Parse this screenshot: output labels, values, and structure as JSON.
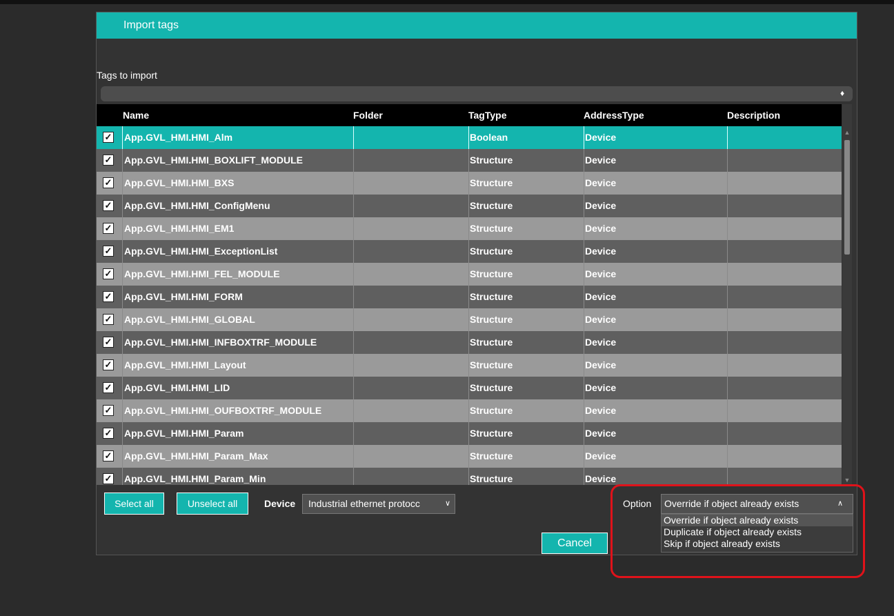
{
  "dialog": {
    "title": "Import tags",
    "tags_label": "Tags to import",
    "filter_icon": "tag-icon"
  },
  "grid": {
    "columns": [
      "Name",
      "Folder",
      "TagType",
      "AddressType",
      "Description"
    ],
    "rows": [
      {
        "name": "App.GVL_HMI.HMI_Alm",
        "folder": "",
        "tagtype": "Boolean",
        "addresstype": "Device",
        "description": "",
        "checked": true,
        "selected": true
      },
      {
        "name": "App.GVL_HMI.HMI_BOXLIFT_MODULE",
        "folder": "",
        "tagtype": "Structure",
        "addresstype": "Device",
        "description": "",
        "checked": true
      },
      {
        "name": "App.GVL_HMI.HMI_BXS",
        "folder": "",
        "tagtype": "Structure",
        "addresstype": "Device",
        "description": "",
        "checked": true
      },
      {
        "name": "App.GVL_HMI.HMI_ConfigMenu",
        "folder": "",
        "tagtype": "Structure",
        "addresstype": "Device",
        "description": "",
        "checked": true
      },
      {
        "name": "App.GVL_HMI.HMI_EM1",
        "folder": "",
        "tagtype": "Structure",
        "addresstype": "Device",
        "description": "",
        "checked": true
      },
      {
        "name": "App.GVL_HMI.HMI_ExceptionList",
        "folder": "",
        "tagtype": "Structure",
        "addresstype": "Device",
        "description": "",
        "checked": true
      },
      {
        "name": "App.GVL_HMI.HMI_FEL_MODULE",
        "folder": "",
        "tagtype": "Structure",
        "addresstype": "Device",
        "description": "",
        "checked": true
      },
      {
        "name": "App.GVL_HMI.HMI_FORM",
        "folder": "",
        "tagtype": "Structure",
        "addresstype": "Device",
        "description": "",
        "checked": true
      },
      {
        "name": "App.GVL_HMI.HMI_GLOBAL",
        "folder": "",
        "tagtype": "Structure",
        "addresstype": "Device",
        "description": "",
        "checked": true
      },
      {
        "name": "App.GVL_HMI.HMI_INFBOXTRF_MODULE",
        "folder": "",
        "tagtype": "Structure",
        "addresstype": "Device",
        "description": "",
        "checked": true
      },
      {
        "name": "App.GVL_HMI.HMI_Layout",
        "folder": "",
        "tagtype": "Structure",
        "addresstype": "Device",
        "description": "",
        "checked": true
      },
      {
        "name": "App.GVL_HMI.HMI_LID",
        "folder": "",
        "tagtype": "Structure",
        "addresstype": "Device",
        "description": "",
        "checked": true
      },
      {
        "name": "App.GVL_HMI.HMI_OUFBOXTRF_MODULE",
        "folder": "",
        "tagtype": "Structure",
        "addresstype": "Device",
        "description": "",
        "checked": true
      },
      {
        "name": "App.GVL_HMI.HMI_Param",
        "folder": "",
        "tagtype": "Structure",
        "addresstype": "Device",
        "description": "",
        "checked": true
      },
      {
        "name": "App.GVL_HMI.HMI_Param_Max",
        "folder": "",
        "tagtype": "Structure",
        "addresstype": "Device",
        "description": "",
        "checked": true
      },
      {
        "name": "App.GVL_HMI.HMI_Param_Min",
        "folder": "",
        "tagtype": "Structure",
        "addresstype": "Device",
        "description": "",
        "checked": true
      }
    ]
  },
  "footer": {
    "select_all": "Select all",
    "unselect_all": "Unselect all",
    "device_label": "Device",
    "device_value": "Industrial ethernet protocc",
    "option_label": "Option",
    "option_value": "Override if object already exists",
    "option_items": [
      "Override if object already exists",
      "Duplicate if object already exists",
      "Skip if object already exists"
    ],
    "cancel": "Cancel"
  },
  "colors": {
    "accent": "#14b5ae",
    "highlight": "#e0121a"
  }
}
